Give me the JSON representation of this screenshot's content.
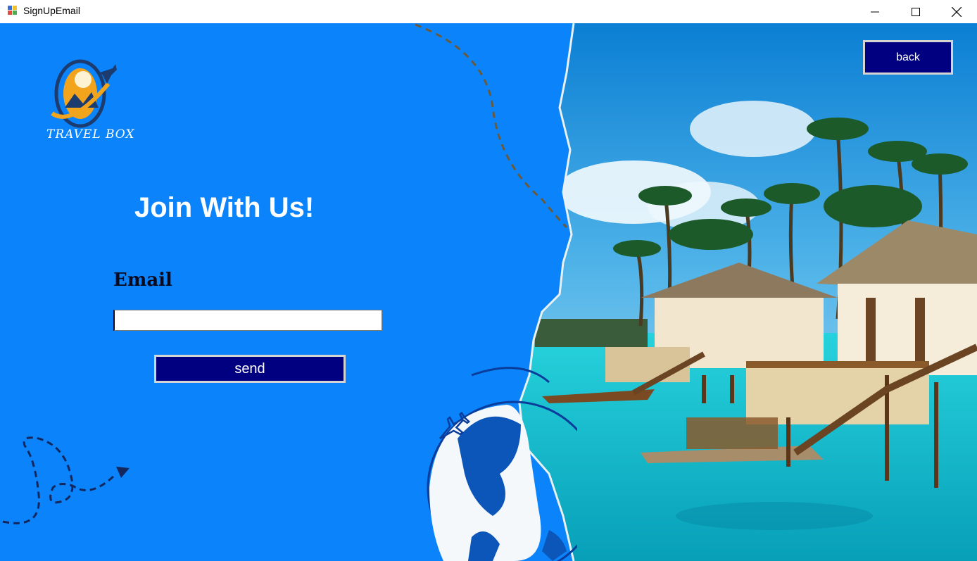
{
  "window": {
    "title": "SignUpEmail",
    "controls": [
      "minimize-icon",
      "maximize-icon",
      "close-icon"
    ]
  },
  "logo": {
    "text": "TRAVEL BOX"
  },
  "form": {
    "heading": "Join With Us!",
    "email_label": "Email",
    "email_value": "",
    "send_label": "send"
  },
  "nav": {
    "back_label": "back"
  },
  "colors": {
    "panel_bg": "#0b84fb",
    "button_bg": "#000080",
    "button_text": "#ffffff",
    "sea": "#1fc3d2"
  }
}
